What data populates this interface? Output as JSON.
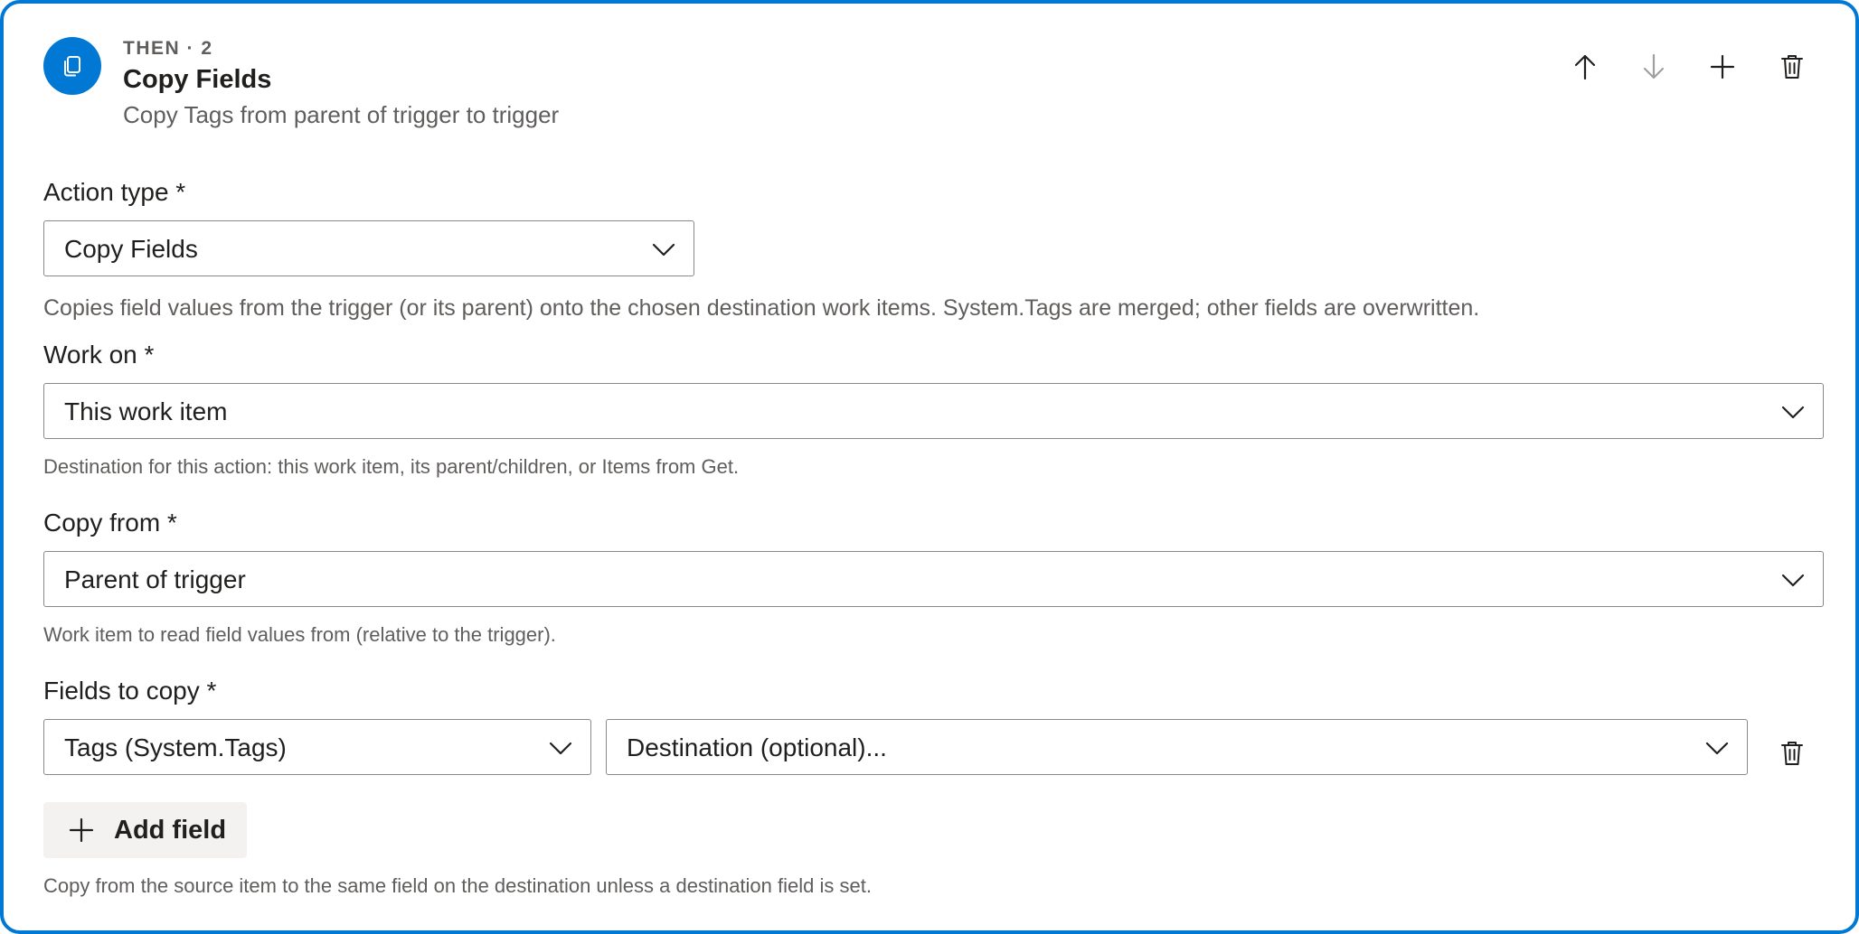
{
  "header": {
    "kicker": "THEN · 2",
    "title": "Copy Fields",
    "subtitle": "Copy Tags from parent of trigger to trigger",
    "icon": "copy-icon",
    "accent": "#0078d4"
  },
  "toolbar": {
    "move_up_icon": "arrow-up-icon",
    "move_down_icon": "arrow-down-icon",
    "add_icon": "plus-icon",
    "delete_icon": "trash-icon"
  },
  "action_type": {
    "label": "Action type *",
    "value": "Copy Fields",
    "description": "Copies field values from the trigger (or its parent) onto the chosen destination work items. System.Tags are merged; other fields are overwritten."
  },
  "work_on": {
    "label": "Work on *",
    "value": "This work item",
    "description": "Destination for this action: this work item, its parent/children, or Items from Get."
  },
  "copy_from": {
    "label": "Copy from *",
    "value": "Parent of trigger",
    "description": "Work item to read field values from (relative to the trigger)."
  },
  "fields_to_copy": {
    "label": "Fields to copy *",
    "rows": [
      {
        "source": "Tags (System.Tags)",
        "destination_placeholder": "Destination (optional)..."
      }
    ],
    "add_label": "Add field",
    "description": "Copy from the source item to the same field on the destination unless a destination field is set."
  }
}
